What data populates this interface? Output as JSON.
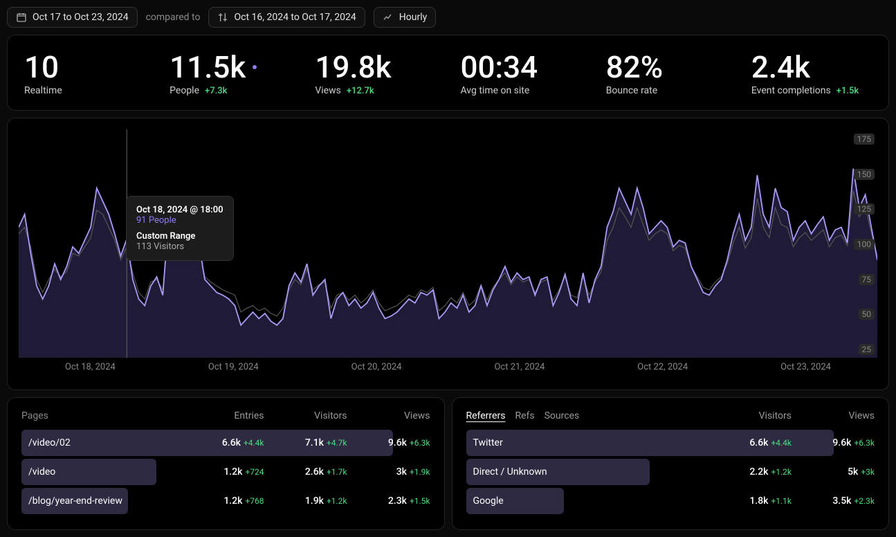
{
  "toolbar": {
    "date_range": "Oct 17 to Oct 23, 2024",
    "compared_to": "compared to",
    "compare_range": "Oct 16, 2024 to Oct 17, 2024",
    "granularity": "Hourly"
  },
  "stats": {
    "realtime": {
      "value": "10",
      "label": "Realtime"
    },
    "people": {
      "value": "11.5k",
      "label": "People",
      "delta": "+7.3k"
    },
    "views": {
      "value": "19.8k",
      "label": "Views",
      "delta": "+12.7k"
    },
    "avg_time": {
      "value": "00:34",
      "label": "Avg time on site"
    },
    "bounce": {
      "value": "82%",
      "label": "Bounce rate"
    },
    "events": {
      "value": "2.4k",
      "label": "Event completions",
      "delta": "+1.5k"
    }
  },
  "tooltip": {
    "time": "Oct 18, 2024 @ 18:00",
    "main": "91 People",
    "sub_label": "Custom Range",
    "sub_value": "113 Visitors"
  },
  "chart_data": {
    "type": "area",
    "ylabel": "People",
    "ylim": [
      0,
      175
    ],
    "yticks": [
      25,
      50,
      75,
      100,
      125,
      150,
      175
    ],
    "x_labels": [
      "Oct 18, 2024",
      "Oct 19, 2024",
      "Oct 20, 2024",
      "Oct 21, 2024",
      "Oct 22, 2024",
      "Oct 23, 2024"
    ],
    "series": [
      {
        "name": "People",
        "values": [
          100,
          110,
          80,
          55,
          45,
          55,
          72,
          60,
          70,
          85,
          80,
          90,
          100,
          130,
          120,
          110,
          95,
          78,
          91,
          60,
          45,
          40,
          55,
          62,
          48,
          108,
          105,
          95,
          92,
          95,
          88,
          60,
          55,
          50,
          48,
          45,
          40,
          25,
          30,
          35,
          30,
          34,
          28,
          25,
          30,
          55,
          65,
          58,
          72,
          48,
          55,
          60,
          30,
          45,
          50,
          40,
          45,
          38,
          42,
          50,
          38,
          30,
          32,
          35,
          40,
          45,
          42,
          50,
          48,
          52,
          30,
          35,
          42,
          38,
          48,
          35,
          40,
          55,
          40,
          52,
          60,
          70,
          58,
          65,
          60,
          62,
          48,
          60,
          62,
          40,
          50,
          64,
          45,
          40,
          65,
          42,
          60,
          70,
          100,
          112,
          130,
          120,
          110,
          130,
          115,
          95,
          100,
          105,
          100,
          85,
          90,
          88,
          70,
          60,
          50,
          48,
          55,
          60,
          75,
          95,
          110,
          90,
          100,
          140,
          110,
          100,
          130,
          115,
          112,
          90,
          100,
          105,
          95,
          102,
          108,
          90,
          98,
          100,
          88,
          145,
          115,
          125,
          100,
          75
        ]
      },
      {
        "name": "Custom Range (comparison)",
        "values": [
          95,
          100,
          85,
          60,
          50,
          60,
          68,
          62,
          66,
          80,
          78,
          85,
          92,
          113,
          110,
          100,
          90,
          75,
          85,
          65,
          50,
          45,
          58,
          60,
          52,
          100,
          98,
          92,
          90,
          92,
          85,
          62,
          58,
          55,
          52,
          50,
          48,
          35,
          38,
          40,
          36,
          38,
          34,
          32,
          38,
          52,
          60,
          56,
          68,
          52,
          56,
          58,
          38,
          48,
          50,
          44,
          48,
          42,
          46,
          52,
          42,
          36,
          38,
          40,
          44,
          48,
          46,
          52,
          50,
          54,
          36,
          40,
          46,
          42,
          50,
          40,
          44,
          56,
          44,
          54,
          60,
          65,
          56,
          62,
          58,
          60,
          50,
          58,
          60,
          44,
          52,
          62,
          48,
          46,
          62,
          48,
          58,
          66,
          90,
          100,
          115,
          108,
          100,
          115,
          102,
          90,
          95,
          98,
          95,
          82,
          86,
          84,
          70,
          62,
          54,
          52,
          58,
          62,
          72,
          88,
          100,
          84,
          92,
          122,
          100,
          92,
          115,
          102,
          100,
          85,
          92,
          96,
          90,
          94,
          98,
          85,
          92,
          94,
          86,
          128,
          108,
          115,
          96,
          78
        ]
      }
    ]
  },
  "pages": {
    "title": "Pages",
    "columns": [
      "Entries",
      "Visitors",
      "Views"
    ],
    "rows": [
      {
        "label": "/video/02",
        "bar_pct": 91,
        "entries": "6.6k",
        "entries_d": "+4.4k",
        "visitors": "7.1k",
        "visitors_d": "+4.7k",
        "views": "9.6k",
        "views_d": "+6.3k"
      },
      {
        "label": "/video",
        "bar_pct": 33,
        "entries": "1.2k",
        "entries_d": "+724",
        "visitors": "2.6k",
        "visitors_d": "+1.7k",
        "views": "3k",
        "views_d": "+1.9k"
      },
      {
        "label": "/blog/year-end-review",
        "bar_pct": 26,
        "entries": "1.2k",
        "entries_d": "+768",
        "visitors": "1.9k",
        "visitors_d": "+1.2k",
        "views": "2.3k",
        "views_d": "+1.5k"
      }
    ]
  },
  "referrers": {
    "tabs": [
      "Referrers",
      "Refs",
      "Sources"
    ],
    "active_tab": 0,
    "columns": [
      "Visitors",
      "Views"
    ],
    "rows": [
      {
        "label": "Twitter",
        "bar_pct": 90,
        "visitors": "6.6k",
        "visitors_d": "+4.4k",
        "views": "9.6k",
        "views_d": "+6.3k"
      },
      {
        "label": "Direct / Unknown",
        "bar_pct": 45,
        "visitors": "2.2k",
        "visitors_d": "+1.2k",
        "views": "5k",
        "views_d": "+3k"
      },
      {
        "label": "Google",
        "bar_pct": 24,
        "visitors": "1.8k",
        "visitors_d": "+1.1k",
        "views": "3.5k",
        "views_d": "+2.3k"
      }
    ]
  }
}
